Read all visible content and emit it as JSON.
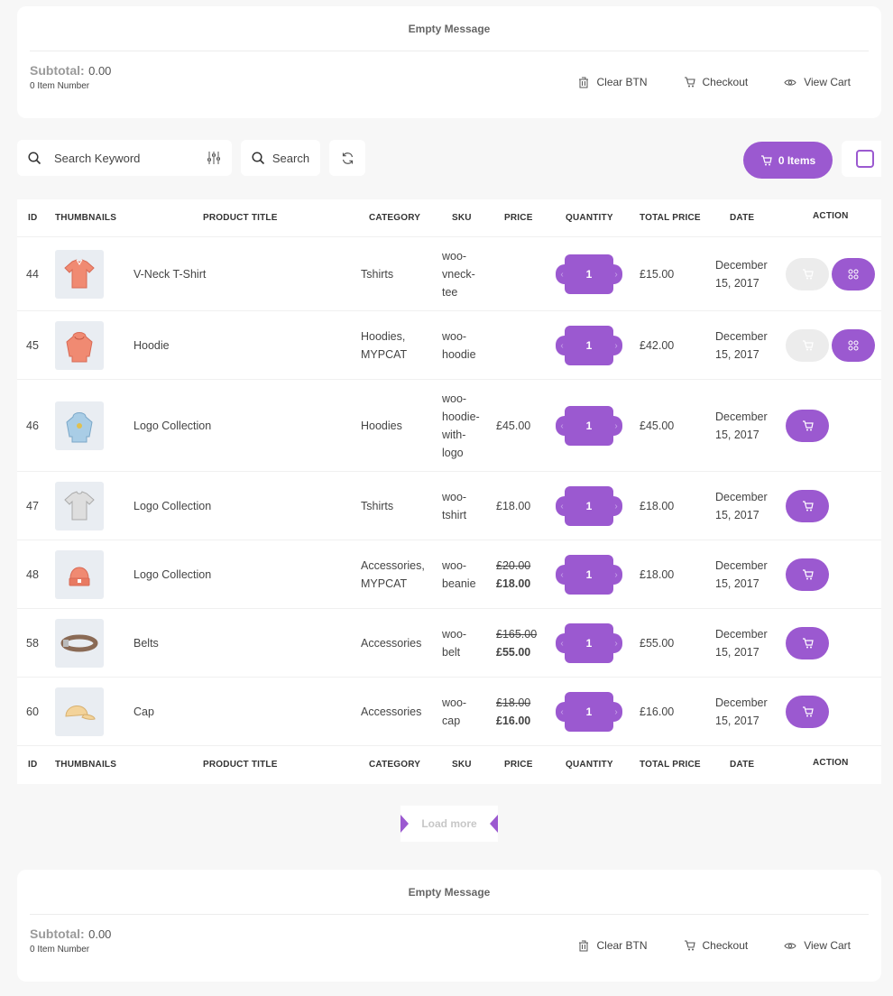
{
  "colors": {
    "accent": "#9b59d0",
    "background": "#f7f7f7"
  },
  "minicart_top": {
    "empty_message": "Empty Message",
    "subtotal_label": "Subtotal:",
    "subtotal_value": "0.00",
    "item_count": "0 Item Number",
    "clear_label": "Clear BTN",
    "checkout_label": "Checkout",
    "view_cart_label": "View Cart"
  },
  "toolbar": {
    "search_placeholder": "Search Keyword",
    "search_label": "Search",
    "items_label": "0 Items"
  },
  "table": {
    "headers": {
      "id": "ID",
      "thumbnails": "THUMBNAILS",
      "title": "PRODUCT TITLE",
      "category": "CATEGORY",
      "sku": "SKU",
      "price": "PRICE",
      "quantity": "QUANTITY",
      "total": "TOTAL PRICE",
      "date": "DATE",
      "action": "ACTION"
    },
    "rows": [
      {
        "id": "44",
        "title": "V-Neck T-Shirt",
        "category": [
          "Tshirts"
        ],
        "sku": [
          "woo-",
          "vneck-",
          "tee"
        ],
        "price_old": "",
        "price": "",
        "qty": "1",
        "total": "£15.00",
        "date": [
          "December",
          "15, 2017"
        ],
        "thumb": "vneck-tshirt-icon",
        "variable": true
      },
      {
        "id": "45",
        "title": "Hoodie",
        "category": [
          "Hoodies,",
          "MYPCAT"
        ],
        "sku": [
          "woo-",
          "hoodie"
        ],
        "price_old": "",
        "price": "",
        "qty": "1",
        "total": "£42.00",
        "date": [
          "December",
          "15, 2017"
        ],
        "thumb": "hoodie-icon",
        "variable": true
      },
      {
        "id": "46",
        "title": "Logo Collection",
        "category": [
          "Hoodies"
        ],
        "sku": [
          "woo-",
          "hoodie-",
          "with-",
          "logo"
        ],
        "price_old": "",
        "price": "£45.00",
        "qty": "1",
        "total": "£45.00",
        "date": [
          "December",
          "15, 2017"
        ],
        "thumb": "hoodie-with-logo-icon",
        "variable": false
      },
      {
        "id": "47",
        "title": "Logo Collection",
        "category": [
          "Tshirts"
        ],
        "sku": [
          "woo-",
          "tshirt"
        ],
        "price_old": "",
        "price": "£18.00",
        "qty": "1",
        "total": "£18.00",
        "date": [
          "December",
          "15, 2017"
        ],
        "thumb": "tshirt-icon",
        "variable": false
      },
      {
        "id": "48",
        "title": "Logo Collection",
        "category": [
          "Accessories,",
          "MYPCAT"
        ],
        "sku": [
          "woo-",
          "beanie"
        ],
        "price_old": "£20.00",
        "price": "£18.00",
        "qty": "1",
        "total": "£18.00",
        "date": [
          "December",
          "15, 2017"
        ],
        "thumb": "beanie-icon",
        "variable": false
      },
      {
        "id": "58",
        "title": "Belts",
        "category": [
          "Accessories"
        ],
        "sku": [
          "woo-",
          "belt"
        ],
        "price_old": "£165.00",
        "price": "£55.00",
        "qty": "1",
        "total": "£55.00",
        "date": [
          "December",
          "15, 2017"
        ],
        "thumb": "belt-icon",
        "variable": false
      },
      {
        "id": "60",
        "title": "Cap",
        "category": [
          "Accessories"
        ],
        "sku": [
          "woo-",
          "cap"
        ],
        "price_old": "£18.00",
        "price": "£16.00",
        "qty": "1",
        "total": "£16.00",
        "date": [
          "December",
          "15, 2017"
        ],
        "thumb": "cap-icon",
        "variable": false
      }
    ]
  },
  "load_more_label": "Load more",
  "minicart_bottom": {
    "empty_message": "Empty Message",
    "subtotal_label": "Subtotal:",
    "subtotal_value": "0.00",
    "item_count": "0 Item Number",
    "clear_label": "Clear BTN",
    "checkout_label": "Checkout",
    "view_cart_label": "View Cart"
  }
}
